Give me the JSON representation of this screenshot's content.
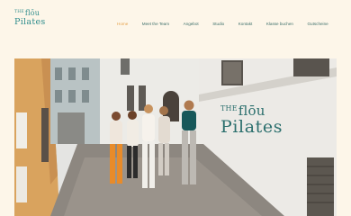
{
  "logo": {
    "line1_small": "THE",
    "line1": "flōu",
    "line2": "Pilates"
  },
  "nav": {
    "items": [
      {
        "label": "Home",
        "active": true
      },
      {
        "label": "Meet the Team",
        "active": false
      },
      {
        "label": "Angebot",
        "active": false
      },
      {
        "label": "Studio",
        "active": false
      },
      {
        "label": "Kontakt",
        "active": false
      },
      {
        "label": "Klasse buchen",
        "active": false
      },
      {
        "label": "Gutscheine",
        "active": false
      }
    ]
  },
  "hero": {
    "title_small": "THE",
    "title_line1": "flōu",
    "title_line2": "Pilates"
  },
  "colors": {
    "background": "#fdf6e9",
    "brand_teal": "#2e8c8c",
    "nav_text": "#3d6f6a",
    "nav_active": "#e6a24c"
  }
}
